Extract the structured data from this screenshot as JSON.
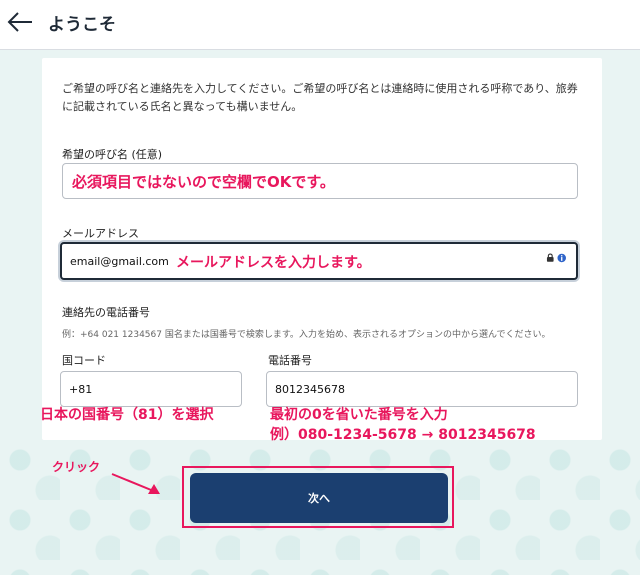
{
  "header": {
    "title": "ようこそ"
  },
  "intro_text": "ご希望の呼び名と連絡先を入力してください。ご希望の呼び名とは連絡時に使用される呼称であり、旅券に記載されている氏名と異なっても構いません。",
  "preferred_name": {
    "label": "希望の呼び名 (任意)",
    "value": "",
    "annotation": "必須項目ではないので空欄でOKです。"
  },
  "email": {
    "label": "メールアドレス",
    "value": "email@gmail.com",
    "annotation": "メールアドレスを入力します。"
  },
  "phone": {
    "section_label": "連絡先の電話番号",
    "hint": "例：+64 021 1234567 国名または国番号で検索します。入力を始め、表示されるオプションの中から選んでください。",
    "country_code_label": "国コード",
    "country_code_value": "+81",
    "number_label": "電話番号",
    "number_value": "8012345678",
    "country_annotation": "日本の国番号（81）を選択",
    "number_annotation_1": "最初の0を省いた番号を入力",
    "number_annotation_2": "例）080-1234-5678 → 8012345678"
  },
  "next_button": {
    "label": "次へ"
  },
  "click_annotation": "クリック",
  "colors": {
    "accent": "#e8175d",
    "button": "#1b3f70",
    "background": "#e9f4f3"
  }
}
